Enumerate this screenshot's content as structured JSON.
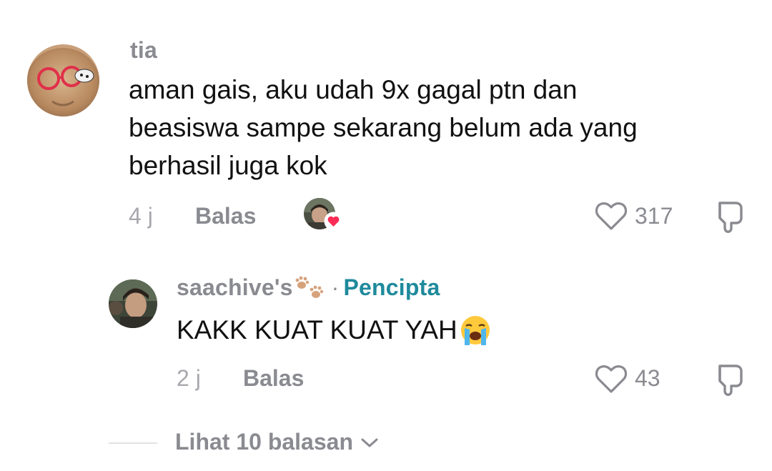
{
  "comment": {
    "username": "tia",
    "text_lines": [
      "aman gais, aku udah 9x gagal ptn dan",
      "beasiswa sampe sekarang belum ada yang",
      "berhasil juga kok"
    ],
    "time": "4 j",
    "reply_label": "Balas",
    "like_count": "317",
    "liked_by_creator": true
  },
  "reply": {
    "username": "saachive's",
    "username_emoji": "paw-prints",
    "separator": "·",
    "creator_badge": "Pencipta",
    "text": "KAKK KUAT KUAT YAH",
    "text_emoji": "loudly-crying-face",
    "time": "2 j",
    "reply_label": "Balas",
    "like_count": "43"
  },
  "view_more_label": "Lihat 10 balasan",
  "colors": {
    "muted_text": "#8a8b91",
    "creator_accent": "#1f8a9c",
    "heart_badge": "#fe2c55"
  }
}
